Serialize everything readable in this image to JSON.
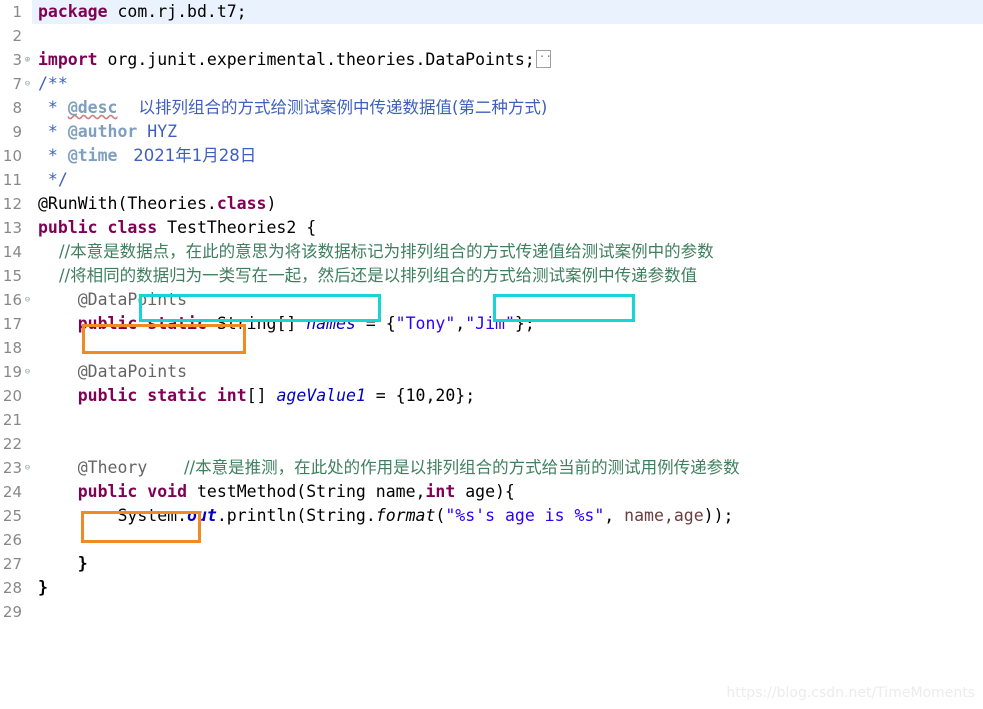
{
  "editor": {
    "watermark": "https://blog.csdn.net/TimeMoments",
    "current_line": 1,
    "colors": {
      "keyword": "#7F0055",
      "string": "#2A00FF",
      "comment": "#3F7F5F",
      "javadoc": "#3F5FBF",
      "javadoc_tag": "#7F9FBF",
      "annotation": "#646464",
      "field": "#0000C0",
      "parameter": "#6A3E3E",
      "line_number": "#888888",
      "current_line_bg": "#EAF2FD",
      "highlight_cyan": "#18D5D5",
      "highlight_orange": "#F08A23",
      "background": "#FFFFFF"
    },
    "gutter": [
      {
        "number": "1",
        "fold": ""
      },
      {
        "number": "2",
        "fold": ""
      },
      {
        "number": "3",
        "fold": "plus"
      },
      {
        "number": "7",
        "fold": "minus"
      },
      {
        "number": "8",
        "fold": ""
      },
      {
        "number": "9",
        "fold": ""
      },
      {
        "number": "10",
        "fold": ""
      },
      {
        "number": "11",
        "fold": ""
      },
      {
        "number": "12",
        "fold": ""
      },
      {
        "number": "13",
        "fold": ""
      },
      {
        "number": "14",
        "fold": ""
      },
      {
        "number": "15",
        "fold": ""
      },
      {
        "number": "16",
        "fold": "minus"
      },
      {
        "number": "17",
        "fold": ""
      },
      {
        "number": "18",
        "fold": ""
      },
      {
        "number": "19",
        "fold": "minus"
      },
      {
        "number": "20",
        "fold": ""
      },
      {
        "number": "21",
        "fold": ""
      },
      {
        "number": "22",
        "fold": ""
      },
      {
        "number": "23",
        "fold": "minus"
      },
      {
        "number": "24",
        "fold": ""
      },
      {
        "number": "25",
        "fold": ""
      },
      {
        "number": "26",
        "fold": ""
      },
      {
        "number": "27",
        "fold": ""
      },
      {
        "number": "28",
        "fold": ""
      },
      {
        "number": "29",
        "fold": ""
      }
    ],
    "code": {
      "l1_package_kw": "package",
      "l1_rest": " com.rj.bd.t7;",
      "l3_import_kw": "import",
      "l3_rest": " org.junit.experimental.theories.DataPoints;",
      "l7_jdoc_open": "/**",
      "l8_star": " * ",
      "l8_tag": "@desc",
      "l8_text": "    以排列组合的方式给测试案例中传递数据值(第二种方式)",
      "l9_star": " * ",
      "l9_tag": "@author",
      "l9_text": " HYZ",
      "l10_star": " * ",
      "l10_tag": "@time",
      "l10_text": "   2021年1月28日",
      "l11_jdoc_close": " */",
      "l12_annotation": "@RunWith(Theories.",
      "l12_class_kw": "class",
      "l12_close": ")",
      "l13_public": "public",
      "l13_sp1": " ",
      "l13_class": "class",
      "l13_name": " TestTheories2 {",
      "l14_comment": "    //本意是数据点，在此的意思为将该数据标记为排列组合的方式传递值给测试案例中的参数",
      "l15_comment": "    //将相同的数据归为一类写在一起，然后还是以排列组合的方式给测试案例中传递参数值",
      "l16_annotation": "    @DataPoints",
      "l17_indent": "    ",
      "l17_public": "public",
      "l17_static": " static",
      "l17_type": " String[] ",
      "l17_field": "names",
      "l17_eq": " = {",
      "l17_str1": "\"Tony\"",
      "l17_comma": ",",
      "l17_str2": "\"Jim\"",
      "l17_end": "};",
      "l19_annotation": "    @DataPoints",
      "l20_indent": "    ",
      "l20_public": "public",
      "l20_static": " static",
      "l20_int": " int",
      "l20_brackets": "[] ",
      "l20_field": "ageValue1",
      "l20_eq": " = {10,20};",
      "l23_annotation": "    @Theory",
      "l23_comment": "       //本意是推测，在此处的作用是以排列组合的方式给当前的测试用例传递参数",
      "l24_indent": "    ",
      "l24_public": "public",
      "l24_void": " void",
      "l24_sig": " testMethod(String name,",
      "l24_int": "int",
      "l24_sig2": " age){",
      "l25_indent": "        ",
      "l25_system": "System.",
      "l25_out": "out",
      "l25_println": ".println(String.",
      "l25_format": "format",
      "l25_paren": "(",
      "l25_str": "\"%s's age is %s\"",
      "l25_comma": ", ",
      "l25_args": "name,age",
      "l25_end": "));",
      "l27_brace": "    }",
      "l28_brace": "}"
    },
    "highlights": [
      {
        "name": "cyan-box-same-data",
        "color": "cyan",
        "label": "相同的数据归为一类写在一起"
      },
      {
        "name": "cyan-box-permutation",
        "color": "cyan",
        "label": "排列组合的方式"
      },
      {
        "name": "orange-box-datapoints",
        "color": "orange",
        "label": "@DataPoints"
      },
      {
        "name": "orange-box-theory",
        "color": "orange",
        "label": "@Theory"
      }
    ]
  }
}
